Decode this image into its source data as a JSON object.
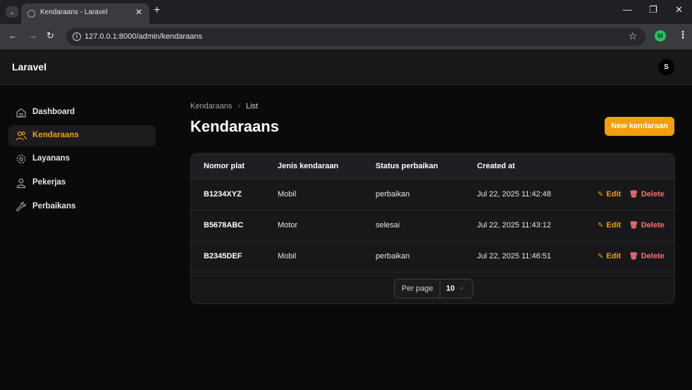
{
  "browser": {
    "tab_title": "Kendaraans - Laravel",
    "url": "127.0.0.1:8000/admin/kendaraans",
    "profile_initial": "M"
  },
  "header": {
    "brand": "Laravel",
    "avatar_initial": "S"
  },
  "sidebar": {
    "items": [
      {
        "label": "Dashboard",
        "icon": "home-icon",
        "active": false
      },
      {
        "label": "Kendaraans",
        "icon": "users-icon",
        "active": true
      },
      {
        "label": "Layanans",
        "icon": "cog-icon",
        "active": false
      },
      {
        "label": "Pekerjas",
        "icon": "user-icon",
        "active": false
      },
      {
        "label": "Perbaikans",
        "icon": "wrench-icon",
        "active": false
      }
    ]
  },
  "main": {
    "breadcrumb": [
      "Kendaraans",
      "List"
    ],
    "title": "Kendaraans",
    "new_button": "New kendaraan",
    "table": {
      "columns": [
        "Nomor plat",
        "Jenis kendaraan",
        "Status perbaikan",
        "Created at"
      ],
      "rows": [
        [
          "B1234XYZ",
          "Mobil",
          "perbaikan",
          "Jul 22, 2025 11:42:48"
        ],
        [
          "B5678ABC",
          "Motor",
          "selesai",
          "Jul 22, 2025 11:43:12"
        ],
        [
          "B2345DEF",
          "Mobil",
          "perbaikan",
          "Jul 22, 2025 11:46:51"
        ]
      ],
      "edit_label": "Edit",
      "delete_label": "Delete"
    },
    "pagination": {
      "per_page_label": "Per page",
      "per_page_value": "10"
    }
  },
  "colors": {
    "accent": "#f59e0b",
    "danger": "#f87171"
  }
}
